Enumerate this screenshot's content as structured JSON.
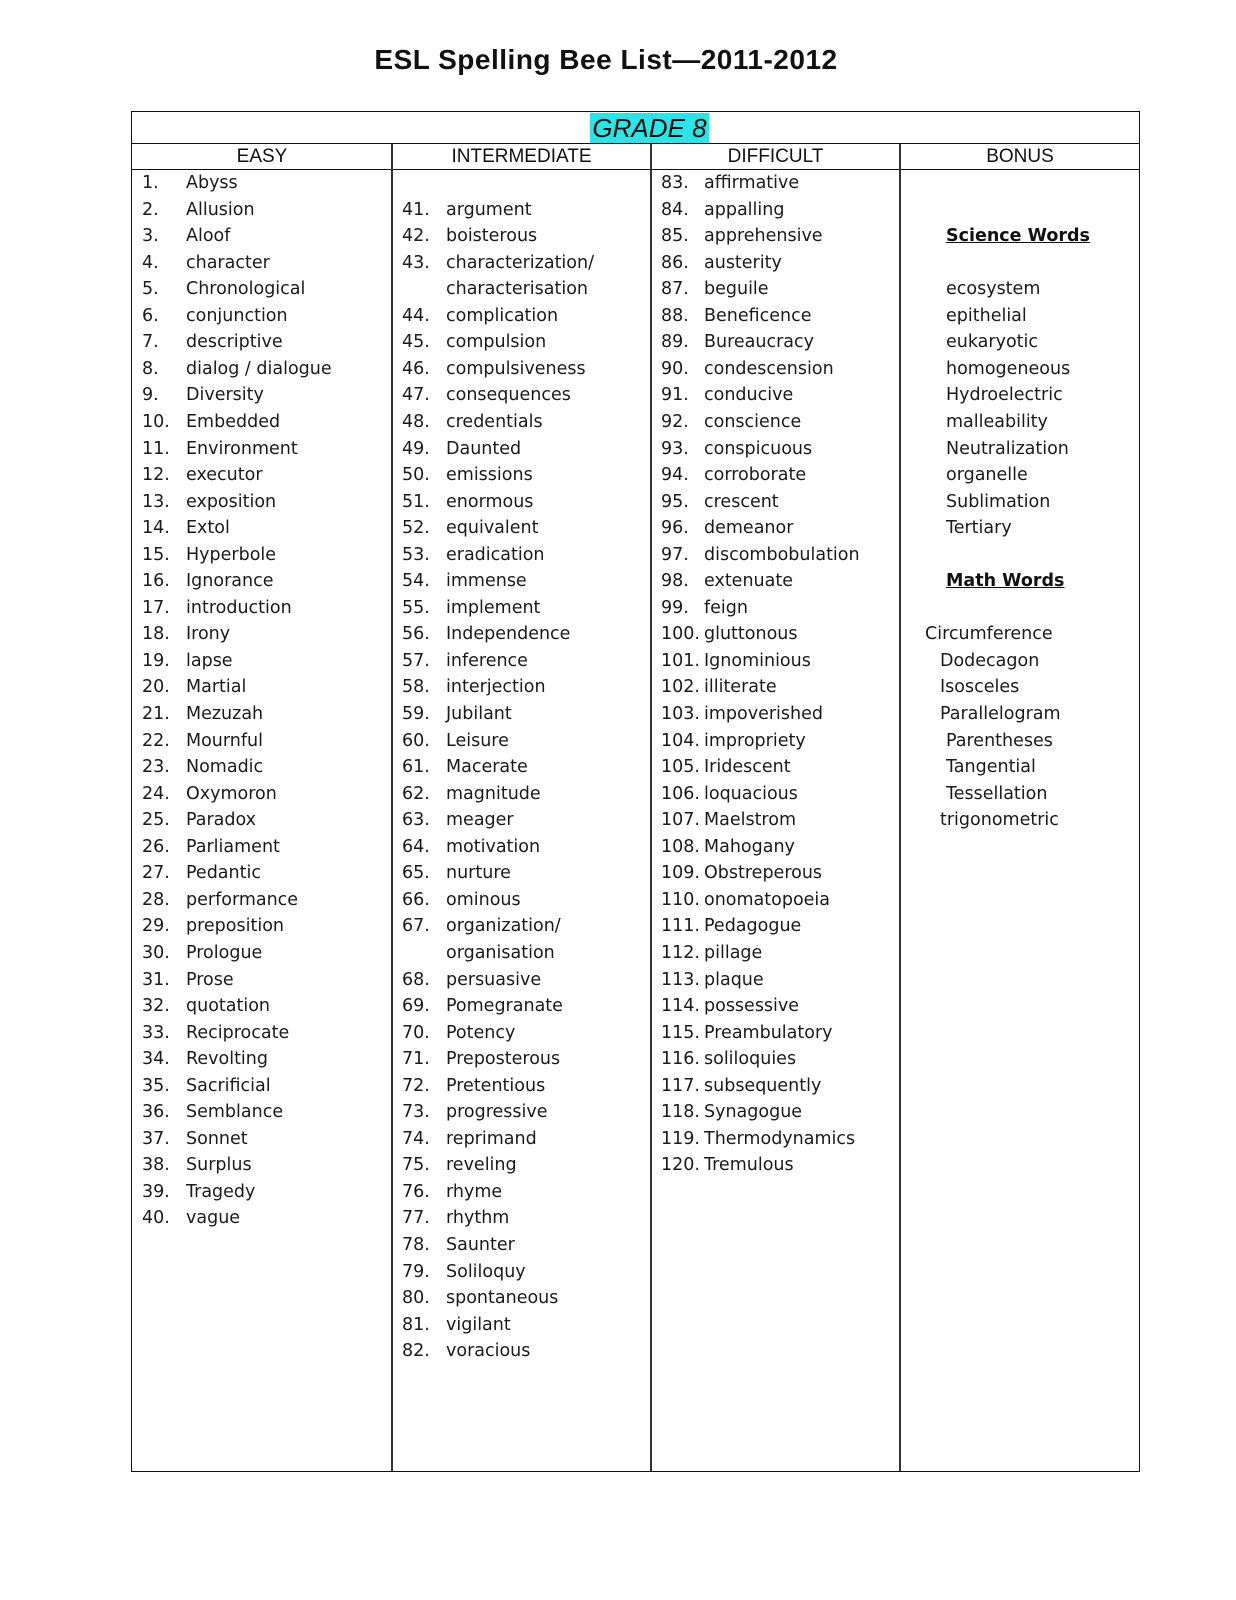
{
  "title": "ESL Spelling Bee List—2011-2012",
  "grade": "GRADE 8",
  "highlight_color": "#2de3e6",
  "columns": {
    "easy": "EASY",
    "intermediate": "INTERMEDIATE",
    "difficult": "DIFFICULT",
    "bonus": "BONUS"
  },
  "easy": [
    {
      "n": "1.",
      "w": "Abyss"
    },
    {
      "n": "2.",
      "w": "Allusion"
    },
    {
      "n": "3.",
      "w": "Aloof"
    },
    {
      "n": "4.",
      "w": "character"
    },
    {
      "n": "5.",
      "w": "Chronological"
    },
    {
      "n": "6.",
      "w": "conjunction"
    },
    {
      "n": "7.",
      "w": "descriptive"
    },
    {
      "n": "8.",
      "w": "dialog / dialogue"
    },
    {
      "n": "9.",
      "w": "Diversity"
    },
    {
      "n": "10.",
      "w": "Embedded"
    },
    {
      "n": "11.",
      "w": "Environment"
    },
    {
      "n": "12.",
      "w": "executor"
    },
    {
      "n": "13.",
      "w": "exposition"
    },
    {
      "n": "14.",
      "w": "Extol"
    },
    {
      "n": "15.",
      "w": "Hyperbole"
    },
    {
      "n": "16.",
      "w": "Ignorance"
    },
    {
      "n": "17.",
      "w": "introduction"
    },
    {
      "n": "18.",
      "w": "Irony"
    },
    {
      "n": "19.",
      "w": "lapse"
    },
    {
      "n": "20.",
      "w": "Martial"
    },
    {
      "n": "21.",
      "w": "Mezuzah"
    },
    {
      "n": "22.",
      "w": "Mournful"
    },
    {
      "n": "23.",
      "w": "Nomadic"
    },
    {
      "n": "24.",
      "w": "Oxymoron"
    },
    {
      "n": "25.",
      "w": "Paradox"
    },
    {
      "n": "26.",
      "w": "Parliament"
    },
    {
      "n": "27.",
      "w": "Pedantic"
    },
    {
      "n": "28.",
      "w": "performance"
    },
    {
      "n": "29.",
      "w": "preposition"
    },
    {
      "n": "30.",
      "w": "Prologue"
    },
    {
      "n": "31.",
      "w": "Prose"
    },
    {
      "n": "32.",
      "w": "quotation"
    },
    {
      "n": "33.",
      "w": "Reciprocate"
    },
    {
      "n": "34.",
      "w": "Revolting"
    },
    {
      "n": "35.",
      "w": "Sacrificial"
    },
    {
      "n": "36.",
      "w": "Semblance"
    },
    {
      "n": "37.",
      "w": "Sonnet"
    },
    {
      "n": "38.",
      "w": "Surplus"
    },
    {
      "n": "39.",
      "w": "Tragedy"
    },
    {
      "n": "40.",
      "w": "vague"
    }
  ],
  "intermediate": [
    {
      "n": "",
      "w": ""
    },
    {
      "n": "41.",
      "w": "argument"
    },
    {
      "n": "42.",
      "w": "boisterous"
    },
    {
      "n": "43.",
      "w": "characterization/"
    },
    {
      "n": "",
      "w": "characterisation"
    },
    {
      "n": "44.",
      "w": "complication"
    },
    {
      "n": "45.",
      "w": "compulsion"
    },
    {
      "n": "46.",
      "w": "compulsiveness"
    },
    {
      "n": "47.",
      "w": "consequences"
    },
    {
      "n": "48.",
      "w": "credentials"
    },
    {
      "n": "49.",
      "w": "Daunted"
    },
    {
      "n": "50.",
      "w": "emissions"
    },
    {
      "n": "51.",
      "w": "enormous"
    },
    {
      "n": "52.",
      "w": "equivalent"
    },
    {
      "n": "53.",
      "w": "eradication"
    },
    {
      "n": "54.",
      "w": "immense"
    },
    {
      "n": "55.",
      "w": "implement"
    },
    {
      "n": "56.",
      "w": "Independence"
    },
    {
      "n": "57.",
      "w": "inference"
    },
    {
      "n": "58.",
      "w": "interjection"
    },
    {
      "n": "59.",
      "w": "Jubilant"
    },
    {
      "n": "60.",
      "w": "Leisure"
    },
    {
      "n": "61.",
      "w": "Macerate"
    },
    {
      "n": "62.",
      "w": "magnitude"
    },
    {
      "n": "63.",
      "w": "meager"
    },
    {
      "n": "64.",
      "w": "motivation"
    },
    {
      "n": "65.",
      "w": "nurture"
    },
    {
      "n": "66.",
      "w": "ominous"
    },
    {
      "n": "67.",
      "w": "organization/"
    },
    {
      "n": "",
      "w": "organisation"
    },
    {
      "n": "68.",
      "w": "persuasive"
    },
    {
      "n": "69.",
      "w": "Pomegranate"
    },
    {
      "n": "70.",
      "w": "Potency"
    },
    {
      "n": "71.",
      "w": "Preposterous"
    },
    {
      "n": "72.",
      "w": "Pretentious"
    },
    {
      "n": "73.",
      "w": "progressive"
    },
    {
      "n": "74.",
      "w": "reprimand"
    },
    {
      "n": "75.",
      "w": "reveling"
    },
    {
      "n": "76.",
      "w": "rhyme"
    },
    {
      "n": "77.",
      "w": "rhythm"
    },
    {
      "n": "78.",
      "w": "Saunter"
    },
    {
      "n": "79.",
      "w": "Soliloquy"
    },
    {
      "n": "80.",
      "w": "spontaneous"
    },
    {
      "n": "81.",
      "w": "vigilant"
    },
    {
      "n": "82.",
      "w": "voracious"
    }
  ],
  "difficult": [
    {
      "n": "83.",
      "w": "affirmative"
    },
    {
      "n": "84.",
      "w": "appalling"
    },
    {
      "n": "85.",
      "w": "apprehensive"
    },
    {
      "n": "86.",
      "w": "austerity"
    },
    {
      "n": "87.",
      "w": "beguile"
    },
    {
      "n": "88.",
      "w": "Beneficence"
    },
    {
      "n": "89.",
      "w": "Bureaucracy"
    },
    {
      "n": "90.",
      "w": "condescension"
    },
    {
      "n": "91.",
      "w": "conducive"
    },
    {
      "n": "92.",
      "w": "conscience"
    },
    {
      "n": "93.",
      "w": "conspicuous"
    },
    {
      "n": "94.",
      "w": "corroborate"
    },
    {
      "n": "95.",
      "w": "crescent"
    },
    {
      "n": "96.",
      "w": "demeanor"
    },
    {
      "n": "97.",
      "w": "discombobulation"
    },
    {
      "n": "98.",
      "w": "extenuate"
    },
    {
      "n": "99.",
      "w": "feign"
    },
    {
      "n": "100.",
      "w": "gluttonous"
    },
    {
      "n": "101.",
      "w": "Ignominious"
    },
    {
      "n": "102.",
      "w": "illiterate"
    },
    {
      "n": "103.",
      "w": "impoverished"
    },
    {
      "n": "104.",
      "w": "impropriety"
    },
    {
      "n": "105.",
      "w": "Iridescent"
    },
    {
      "n": "106.",
      "w": "loquacious"
    },
    {
      "n": "107.",
      "w": "Maelstrom"
    },
    {
      "n": "108.",
      "w": "Mahogany"
    },
    {
      "n": "109.",
      "w": "Obstreperous"
    },
    {
      "n": "110.",
      "w": "onomatopoeia"
    },
    {
      "n": "111.",
      "w": "Pedagogue"
    },
    {
      "n": "112.",
      "w": "pillage"
    },
    {
      "n": "113.",
      "w": "plaque"
    },
    {
      "n": "114.",
      "w": "possessive"
    },
    {
      "n": "115.",
      "w": "Preambulatory"
    },
    {
      "n": "116.",
      "w": "soliloquies"
    },
    {
      "n": "117.",
      "w": "subsequently"
    },
    {
      "n": "118.",
      "w": "Synagogue"
    },
    {
      "n": "119.",
      "w": "Thermodynamics"
    },
    {
      "n": "120.",
      "w": "Tremulous"
    }
  ],
  "bonus": {
    "science_heading": "Science Words",
    "science_words": [
      "ecosystem",
      "epithelial",
      "eukaryotic",
      "homogeneous",
      "Hydroelectric",
      "malleability",
      "Neutralization",
      "organelle",
      "Sublimation",
      "Tertiary"
    ],
    "math_heading": "Math Words",
    "math_words": [
      "Circumference",
      "Dodecagon",
      "Isosceles",
      "Parallelogram",
      "Parentheses",
      "Tangential",
      "Tessellation",
      "trigonometric"
    ]
  }
}
